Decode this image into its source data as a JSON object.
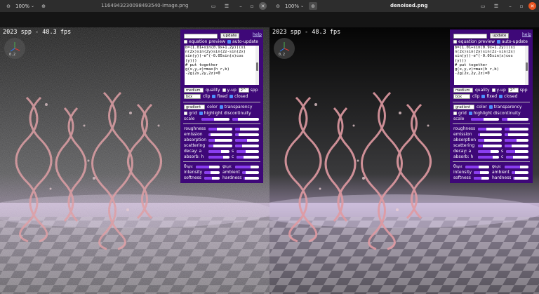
{
  "windows": [
    {
      "id": "left",
      "title": "1164943230098493540-image.png",
      "zoom": "100%",
      "variant": "noisy"
    },
    {
      "id": "right",
      "title": "denoised.png",
      "zoom": "100%",
      "variant": "clean"
    }
  ],
  "viewer": {
    "overlay_text": "2023 spp - 48.3 fps",
    "gizmo_value": "0.2"
  },
  "panel": {
    "update_label": "update",
    "help_label": "help",
    "equation_preview_label": "equation preview",
    "auto_update_label": "auto-update",
    "code_lines": [
      "b=(1.01+sin(0.9x+1.2y))(si",
      "n(2x)sin(2y)sin(2z-sin(2x)",
      "sin(y))-e^(-0.05sin(x)cos",
      "(y)))",
      "# put together",
      "g(x,y,z)=max(h_r,b)",
      "-2g(2x,2y,2z)=0"
    ],
    "quality_select": "medium",
    "quality_label": "quality",
    "yup_label": "y-up",
    "spp_select": "2^",
    "spp_label": "spp",
    "clip_select": "box",
    "clip_label": "clip",
    "fixed_label": "fixed",
    "closed_label": "closed",
    "color_select": "gradient",
    "color_label": "color",
    "transparency_label": "transparency",
    "grid_label": "grid",
    "highlight_label": "highlight discontinuity",
    "scale_label": "scale",
    "roughness_label": "roughness",
    "emission_label": "emission",
    "absorption_label": "absorption",
    "scattering_label": "scattering",
    "decay_label": "decay: a",
    "decay_s_label": "s",
    "absorb_label": "absorb: h",
    "absorb_c_label": "c",
    "theta_light_label": "θ",
    "phi_light_label": "φ",
    "light_sub": "light",
    "intensity_label": "intensity",
    "ambient_label": "ambient",
    "softness_label": "softness",
    "hardness_label": "hardness",
    "sliders": {
      "scale_a": 0.45,
      "scale_b": 0.2,
      "roughness_a": 0.35,
      "roughness_b": 0.2,
      "emission_a": 0.1,
      "emission_b": 0.15,
      "absorption_a": 0.25,
      "absorption_b": 0.5,
      "scattering_a": 0.2,
      "scattering_b": 0.3,
      "decay_a": 0.6,
      "decay_s": 0.4,
      "absorb_h": 0.7,
      "absorb_c": 0.3,
      "theta_light": 0.55,
      "phi_light": 0.65,
      "intensity": 0.4,
      "ambient": 0.2,
      "softness": 0.5,
      "hardness": 0.1
    }
  },
  "colors": {
    "panel_bg": "#3e0878",
    "slider_fill": "#8a3df0",
    "close_active": "#e95420"
  }
}
